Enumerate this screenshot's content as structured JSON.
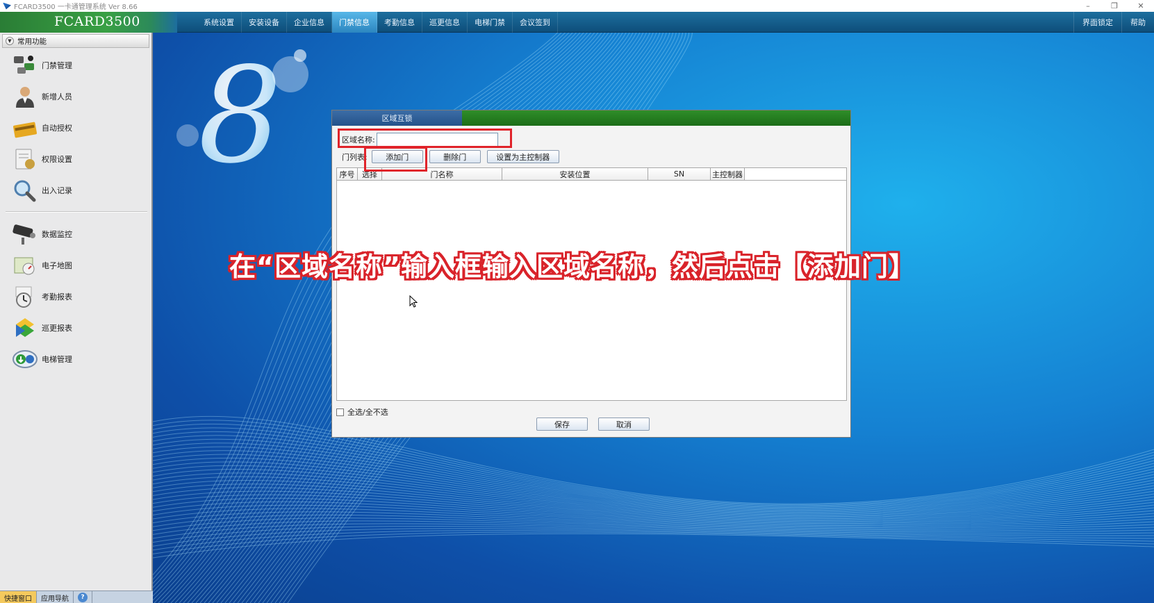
{
  "window": {
    "title": "FCARD3500 一卡通管理系统  Ver 8.66",
    "minimize": "–",
    "restore": "❐",
    "close": "✕"
  },
  "brand": "FCARD3500",
  "menu": {
    "items": [
      "系统设置",
      "安装设备",
      "企业信息",
      "门禁信息",
      "考勤信息",
      "巡更信息",
      "电梯门禁",
      "会议签到"
    ],
    "active": "门禁信息",
    "right": [
      "界面锁定",
      "帮助"
    ]
  },
  "sidebar": {
    "header": "常用功能",
    "group1": [
      {
        "label": "门禁管理",
        "icon": "door-control-icon"
      },
      {
        "label": "新增人员",
        "icon": "person-icon"
      },
      {
        "label": "自动授权",
        "icon": "card-icon"
      },
      {
        "label": "权限设置",
        "icon": "permission-icon"
      },
      {
        "label": "出入记录",
        "icon": "magnifier-icon"
      }
    ],
    "group2": [
      {
        "label": "数据监控",
        "icon": "camera-icon"
      },
      {
        "label": "电子地图",
        "icon": "map-icon"
      },
      {
        "label": "考勤报表",
        "icon": "clock-icon"
      },
      {
        "label": "巡更报表",
        "icon": "patrol-icon"
      },
      {
        "label": "电梯管理",
        "icon": "elevator-icon"
      }
    ],
    "bottom_tabs": [
      "快捷窗口",
      "应用导航",
      "?"
    ]
  },
  "dialog": {
    "title": "区域互锁",
    "name_label": "区域名称:",
    "name_value": "",
    "doors_label": "门列表:",
    "buttons": {
      "add": "添加门",
      "delete": "删除门",
      "set_master": "设置为主控制器"
    },
    "columns": [
      "序号",
      "选择",
      "门名称",
      "安装位置",
      "SN",
      "主控制器"
    ],
    "select_all": "全选/全不选",
    "save": "保存",
    "cancel": "取消"
  },
  "caption": "在“区域名称”输入框输入区域名称，然后点击【添加门】",
  "colors": {
    "highlight": "#e0232a",
    "menubar": "#1d6e9e",
    "brand_green": "#39a044",
    "active_menu": "#58b7e8"
  }
}
